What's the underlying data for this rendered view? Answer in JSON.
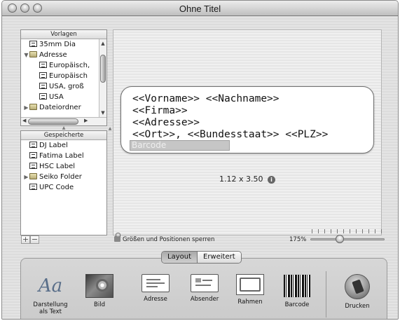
{
  "window": {
    "title": "Ohne Titel"
  },
  "templates": {
    "header": "Vorlagen",
    "items": [
      {
        "label": "35mm Dia",
        "type": "doc",
        "level": 0,
        "disclosure": ""
      },
      {
        "label": "Adresse",
        "type": "folder",
        "level": 0,
        "disclosure": "▼"
      },
      {
        "label": "Europäisch,",
        "type": "doc",
        "level": 1,
        "disclosure": ""
      },
      {
        "label": "Europäisch",
        "type": "doc",
        "level": 1,
        "disclosure": ""
      },
      {
        "label": "USA, groß",
        "type": "doc",
        "level": 1,
        "disclosure": ""
      },
      {
        "label": "USA",
        "type": "doc",
        "level": 1,
        "disclosure": ""
      },
      {
        "label": "Dateiordner",
        "type": "folder",
        "level": 0,
        "disclosure": "▶"
      }
    ]
  },
  "saved": {
    "header": "Gespeicherte",
    "items": [
      {
        "label": "DJ Label",
        "type": "doc",
        "disclosure": ""
      },
      {
        "label": "Fatima Label",
        "type": "doc",
        "disclosure": ""
      },
      {
        "label": "HSC Label",
        "type": "doc",
        "disclosure": ""
      },
      {
        "label": "Seiko Folder",
        "type": "folder",
        "disclosure": "▶"
      },
      {
        "label": "UPC Code",
        "type": "doc",
        "disclosure": ""
      }
    ]
  },
  "label": {
    "lines": [
      "<<Vorname>> <<Nachname>>",
      "<<Firma>>",
      "<<Adresse>>",
      "<<Ort>>, <<Bundesstaat>> <<PLZ>>"
    ],
    "barcode_placeholder": "Barcode",
    "dimensions": "1.12 x 3.50"
  },
  "controls": {
    "add": "+",
    "remove": "−",
    "lock_label": "Größen und Positionen sperren",
    "zoom": "175%",
    "zoom_fraction": 0.4
  },
  "tabs": {
    "layout": "Layout",
    "advanced": "Erweitert"
  },
  "toolbar": {
    "items": [
      {
        "label": "Darstellung\nals Text",
        "icon": "text-style-icon"
      },
      {
        "label": "Bild",
        "icon": "image-icon"
      },
      {
        "label": "Adresse",
        "icon": "address-icon"
      },
      {
        "label": "Absender",
        "icon": "sender-icon"
      },
      {
        "label": "Rahmen",
        "icon": "frame-icon"
      },
      {
        "label": "Barcode",
        "icon": "barcode-icon"
      },
      {
        "label": "Drucken",
        "icon": "print-icon"
      }
    ]
  }
}
